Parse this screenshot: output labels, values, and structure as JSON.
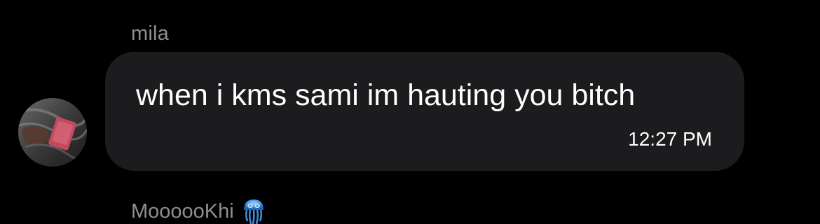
{
  "message": {
    "sender_name": "mila",
    "text": "when i kms sami im hauting you bitch",
    "time": "12:27 PM",
    "avatar_icon": "avatar-photo"
  },
  "next_message": {
    "sender_name": "MoooooKhi",
    "emoji_icon": "jellyfish-icon"
  },
  "colors": {
    "background": "#000000",
    "bubble": "#1c1c1e",
    "sender_name": "#8e8e93",
    "message_text": "#ffffff"
  }
}
